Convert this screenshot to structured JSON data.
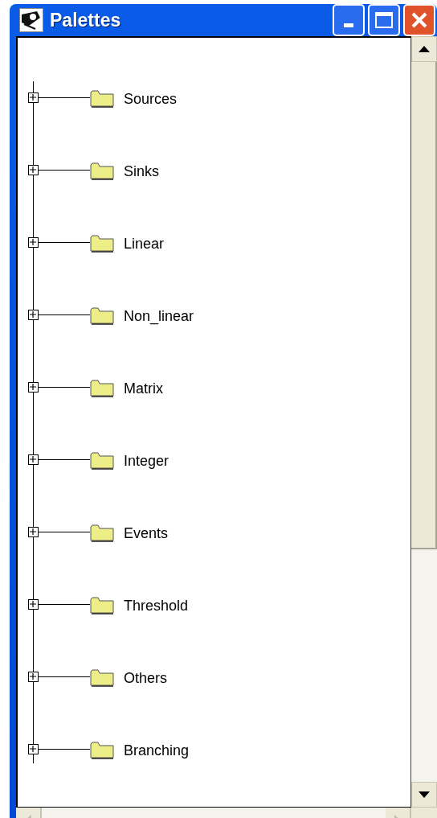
{
  "window": {
    "title": "Palettes"
  },
  "tree": {
    "items": [
      {
        "label": "Sources",
        "expanded": false
      },
      {
        "label": "Sinks",
        "expanded": false
      },
      {
        "label": "Linear",
        "expanded": false
      },
      {
        "label": "Non_linear",
        "expanded": false
      },
      {
        "label": "Matrix",
        "expanded": false
      },
      {
        "label": "Integer",
        "expanded": false
      },
      {
        "label": "Events",
        "expanded": false
      },
      {
        "label": "Threshold",
        "expanded": false
      },
      {
        "label": "Others",
        "expanded": false
      },
      {
        "label": "Branching",
        "expanded": false
      }
    ]
  }
}
